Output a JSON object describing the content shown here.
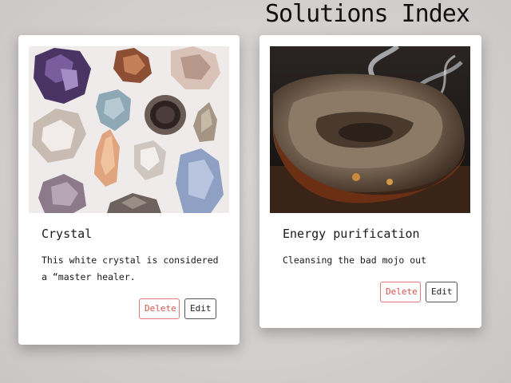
{
  "page": {
    "title": "Solutions Index"
  },
  "cards": [
    {
      "title": "Crystal",
      "text": "This white crystal is considered a “master healer.",
      "delete_label": "Delete",
      "edit_label": "Edit",
      "image": "crystals-photo"
    },
    {
      "title": "Energy purification",
      "text": "Cleansing the bad mojo out",
      "delete_label": "Delete",
      "edit_label": "Edit",
      "image": "smudging-shell-photo"
    }
  ],
  "colors": {
    "delete": "#d9534f",
    "edit_border": "#555555"
  }
}
